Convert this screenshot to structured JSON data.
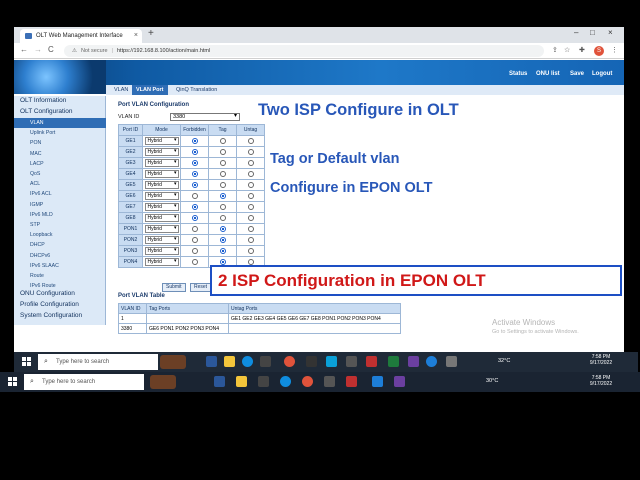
{
  "browser": {
    "tab_title": "OLT Web Management Interface",
    "tab_close": "×",
    "new_tab": "+",
    "window_controls": [
      "–",
      "□",
      "×"
    ],
    "nav": {
      "back": "←",
      "forward": "→",
      "reload": "C"
    },
    "security_warning": "Not secure",
    "separator": "|",
    "url": "https://192.168.8.100/action/main.html",
    "profile_initial": "S"
  },
  "app": {
    "top_links": [
      "Status",
      "ONU list",
      "Save",
      "Logout"
    ],
    "sub_tabs": [
      "VLAN",
      "VLAN Port",
      "QinQ Translation"
    ],
    "active_sub_tab": 1,
    "sidebar": {
      "headings_top": [
        "OLT Information",
        "OLT Configuration"
      ],
      "items": [
        "VLAN",
        "Uplink Port",
        "PON",
        "MAC",
        "LACP",
        "QoS",
        "ACL",
        "IPv6 ACL",
        "IGMP",
        "IPv6 MLD",
        "STP",
        "Loopback",
        "DHCP",
        "DHCPv6",
        "IPv6 SLAAC",
        "Route",
        "IPv6 Route"
      ],
      "active_item": 0,
      "headings_bottom": [
        "ONU Configuration",
        "Profile Configuration",
        "System Configuration"
      ]
    },
    "port_vlan_config": {
      "title": "Port VLAN Configuration",
      "vlan_id_label": "VLAN ID",
      "vlan_id_value": "3380",
      "headers": [
        "Port ID",
        "Mode",
        "Forbidden",
        "Tag",
        "Untag"
      ],
      "rows": [
        {
          "port": "GE1",
          "mode": "Hybrid",
          "sel": 0
        },
        {
          "port": "GE2",
          "mode": "Hybrid",
          "sel": 0
        },
        {
          "port": "GE3",
          "mode": "Hybrid",
          "sel": 0
        },
        {
          "port": "GE4",
          "mode": "Hybrid",
          "sel": 0
        },
        {
          "port": "GE5",
          "mode": "Hybrid",
          "sel": 0
        },
        {
          "port": "GE6",
          "mode": "Hybrid",
          "sel": 1
        },
        {
          "port": "GE7",
          "mode": "Hybrid",
          "sel": 0
        },
        {
          "port": "GE8",
          "mode": "Hybrid",
          "sel": 0
        },
        {
          "port": "PON1",
          "mode": "Hybrid",
          "sel": 1
        },
        {
          "port": "PON2",
          "mode": "Hybrid",
          "sel": 1
        },
        {
          "port": "PON3",
          "mode": "Hybrid",
          "sel": 1
        },
        {
          "port": "PON4",
          "mode": "Hybrid",
          "sel": 1
        }
      ],
      "submit_label": "Submit",
      "reset_label": "Reset"
    },
    "port_vlan_table": {
      "title": "Port VLAN Table",
      "headers": [
        "VLAN ID",
        "Tag Ports",
        "Untag Ports"
      ],
      "rows": [
        {
          "vlan": "1",
          "tag": "",
          "untag": "GE1 GE2 GE3 GE4 GE5 GE6 GE7 GE8 PON1 PON2 PON3 PON4"
        },
        {
          "vlan": "3380",
          "tag": "GE6 PON1 PON2 PON3 PON4",
          "untag": ""
        }
      ]
    }
  },
  "overlay": {
    "line1": "Two ISP Configure in OLT",
    "line2": "Tag or Default vlan",
    "line3": "Configure in EPON OLT",
    "box": "2 ISP Configuration in EPON OLT"
  },
  "watermark": {
    "line1": "Activate Windows",
    "line2": "Go to Settings to activate Windows."
  },
  "taskbar_inner": {
    "search_placeholder": "Type here to search",
    "temp": "32°C",
    "time": "7:58 PM",
    "date": "9/17/2022"
  },
  "taskbar_outer": {
    "search_placeholder": "Type here to search",
    "temp": "30°C",
    "time": "7:58 PM",
    "date": "9/17/2022"
  },
  "icons": {
    "search": "search-icon",
    "lock": "lock-icon",
    "star": "star-icon"
  }
}
